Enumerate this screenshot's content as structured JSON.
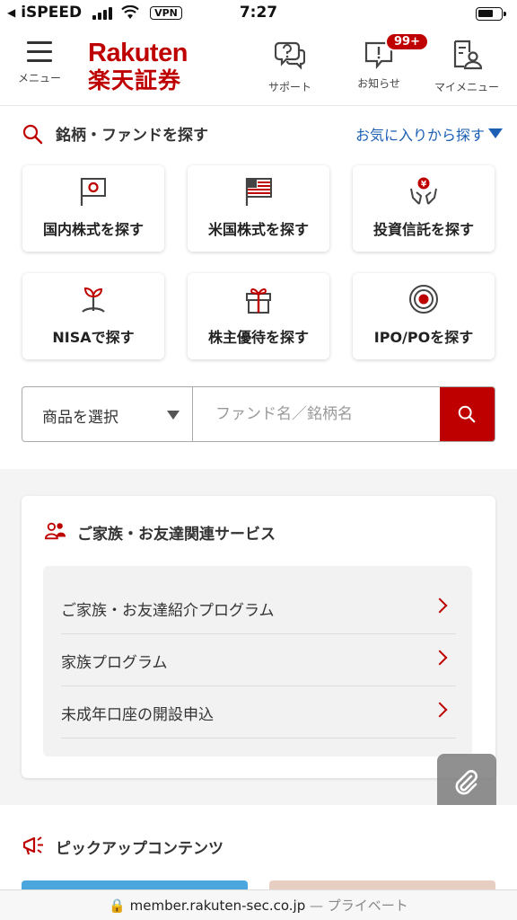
{
  "status_bar": {
    "back_label": "◀",
    "carrier": "iSPEED",
    "vpn": "VPN",
    "time": "7:27"
  },
  "header": {
    "menu_label": "メニュー",
    "logo_top": "Rakuten",
    "logo_bottom": "楽天証券",
    "support_label": "サポート",
    "notice_label": "お知らせ",
    "notice_badge": "99+",
    "mymenu_label": "マイメニュー",
    "brand_color": "#bf0000"
  },
  "search": {
    "title": "銘柄・ファンドを探す",
    "favorites_link": "お気に入りから探す",
    "cards": [
      {
        "label": "国内株式を探す",
        "icon": "japan-flag-icon"
      },
      {
        "label": "米国株式を探す",
        "icon": "us-flag-icon"
      },
      {
        "label": "投資信託を探す",
        "icon": "yen-hands-icon"
      },
      {
        "label": "NISAで探す",
        "icon": "sprout-icon"
      },
      {
        "label": "株主優待を探す",
        "icon": "gift-icon"
      },
      {
        "label": "IPO/POを探す",
        "icon": "target-icon"
      }
    ],
    "select_value": "商品を選択",
    "input_placeholder": "ファンド名／銘柄名"
  },
  "family": {
    "title": "ご家族・お友達関連サービス",
    "items": [
      {
        "label": "ご家族・お友達紹介プログラム"
      },
      {
        "label": "家族プログラム"
      },
      {
        "label": "未成年口座の開設申込"
      }
    ]
  },
  "pickup": {
    "title": "ピックアップコンテンツ"
  },
  "url_bar": {
    "domain": "member.rakuten-sec.co.jp",
    "privacy": " — プライベート"
  }
}
